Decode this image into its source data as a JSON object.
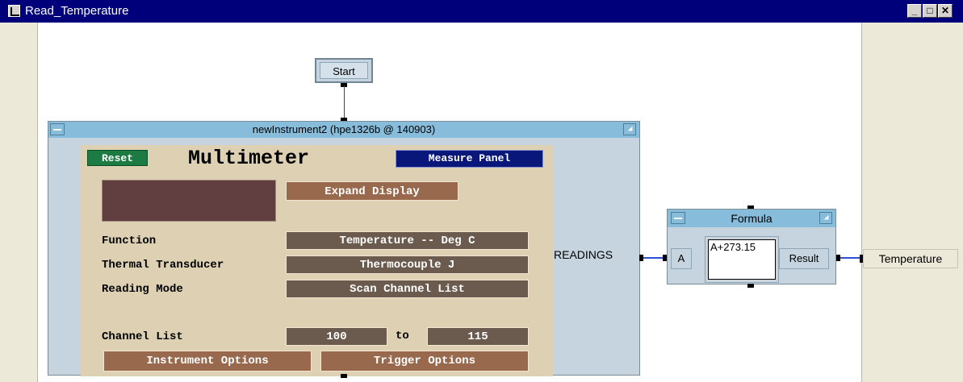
{
  "window": {
    "title": "Read_Temperature",
    "controls": [
      "_",
      "□",
      "✕"
    ]
  },
  "start": {
    "label": "Start"
  },
  "instrument": {
    "title": "newInstrument2 (hpe1326b @ 140903)",
    "reset_label": "Reset",
    "heading": "Multimeter",
    "measure_panel_label": "Measure Panel",
    "expand_display_label": "Expand Display",
    "function_label": "Function",
    "function_value": "Temperature -- Deg C",
    "thermal_label": "Thermal Transducer",
    "thermal_value": "Thermocouple J",
    "reading_mode_label": "Reading Mode",
    "reading_mode_value": "Scan Channel List",
    "channel_list_label": "Channel List",
    "channel_from": "100",
    "channel_to_word": "to",
    "channel_to": "115",
    "instrument_options_label": "Instrument Options",
    "trigger_options_label": "Trigger Options",
    "output_terminal": "READINGS"
  },
  "formula": {
    "title": "Formula",
    "input": "A",
    "expression": "A+273.15",
    "output": "Result"
  },
  "output_terminal": {
    "label": "Temperature"
  },
  "colors": {
    "title_bar": "#00007a",
    "object_title": "#87bcdb",
    "reset_button": "#1c7a43",
    "measure_button": "#0a177a",
    "panel_bg": "#ddd0b3",
    "wire": "#2b4fd6"
  }
}
